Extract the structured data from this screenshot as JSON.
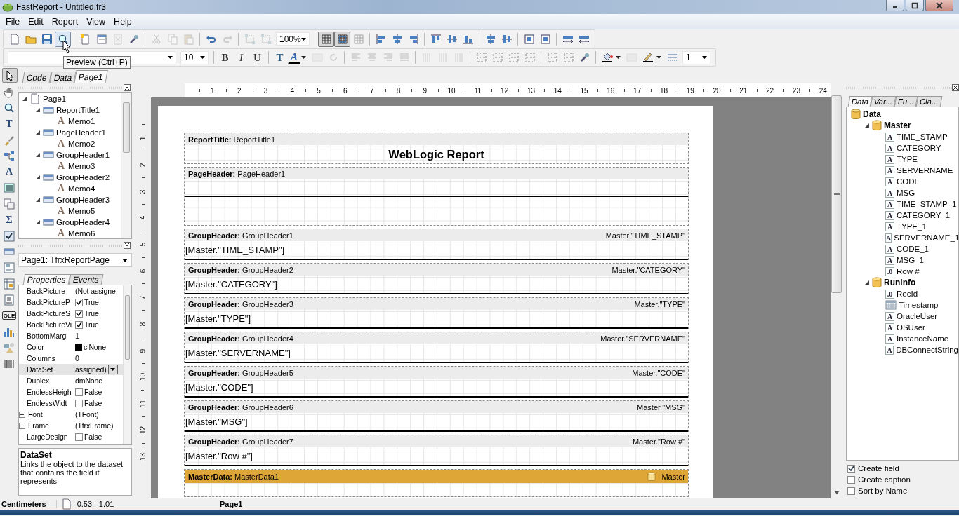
{
  "window": {
    "title": "FastReport - Untitled.fr3"
  },
  "menu": [
    {
      "label": "File"
    },
    {
      "label": "Edit"
    },
    {
      "label": "Report"
    },
    {
      "label": "View"
    },
    {
      "label": "Help"
    }
  ],
  "toolbar_main": [
    {
      "kind": "button",
      "disabled": false,
      "hovered": false,
      "pressed": false
    },
    {
      "kind": "button",
      "disabled": false,
      "hovered": false,
      "pressed": false
    },
    {
      "kind": "button",
      "disabled": false,
      "hovered": false,
      "pressed": false
    },
    {
      "kind": "button",
      "disabled": false,
      "hovered": true,
      "pressed": false
    },
    {
      "kind": "sep"
    },
    {
      "kind": "button",
      "disabled": false,
      "hovered": false,
      "pressed": false
    },
    {
      "kind": "button",
      "disabled": false,
      "hovered": false,
      "pressed": false
    },
    {
      "kind": "button",
      "disabled": true,
      "hovered": false,
      "pressed": false
    },
    {
      "kind": "button",
      "disabled": false,
      "hovered": false,
      "pressed": false
    },
    {
      "kind": "sep"
    },
    {
      "kind": "button",
      "disabled": true,
      "hovered": false,
      "pressed": false
    },
    {
      "kind": "button",
      "disabled": true,
      "hovered": false,
      "pressed": false
    },
    {
      "kind": "button",
      "disabled": true,
      "hovered": false,
      "pressed": false
    },
    {
      "kind": "sep"
    },
    {
      "kind": "button",
      "disabled": false,
      "hovered": false,
      "pressed": false
    },
    {
      "kind": "button",
      "disabled": true,
      "hovered": false,
      "pressed": false
    },
    {
      "kind": "sep"
    },
    {
      "kind": "button",
      "disabled": true,
      "hovered": false,
      "pressed": false
    },
    {
      "kind": "button",
      "disabled": true,
      "hovered": false,
      "pressed": false
    },
    {
      "kind": "combo",
      "value": "100%"
    },
    {
      "kind": "sep"
    },
    {
      "kind": "button",
      "disabled": false,
      "hovered": false,
      "pressed": true
    },
    {
      "kind": "button",
      "disabled": false,
      "hovered": false,
      "pressed": true
    },
    {
      "kind": "button",
      "disabled": true,
      "hovered": false,
      "pressed": false
    },
    {
      "kind": "sep"
    },
    {
      "kind": "button",
      "disabled": false,
      "hovered": false,
      "pressed": false
    },
    {
      "kind": "button",
      "disabled": false,
      "hovered": false,
      "pressed": false
    },
    {
      "kind": "button",
      "disabled": false,
      "hovered": false,
      "pressed": false
    },
    {
      "kind": "sep"
    },
    {
      "kind": "button",
      "disabled": false,
      "hovered": false,
      "pressed": false
    },
    {
      "kind": "button",
      "disabled": false,
      "hovered": false,
      "pressed": false
    },
    {
      "kind": "button",
      "disabled": false,
      "hovered": false,
      "pressed": false
    },
    {
      "kind": "sep"
    },
    {
      "kind": "button",
      "disabled": false,
      "hovered": false,
      "pressed": false
    },
    {
      "kind": "button",
      "disabled": false,
      "hovered": false,
      "pressed": false
    },
    {
      "kind": "sep"
    },
    {
      "kind": "button",
      "disabled": false,
      "hovered": false,
      "pressed": false
    },
    {
      "kind": "button",
      "disabled": false,
      "hovered": false,
      "pressed": false
    },
    {
      "kind": "sep"
    },
    {
      "kind": "button",
      "disabled": false,
      "hovered": false,
      "pressed": false
    },
    {
      "kind": "button",
      "disabled": false,
      "hovered": false,
      "pressed": false
    }
  ],
  "toolbar_format": [
    {
      "kind": "font_combo"
    },
    {
      "kind": "combo",
      "value": "10"
    },
    {
      "kind": "sep"
    },
    {
      "kind": "glyph",
      "text": "B",
      "disabled": false
    },
    {
      "kind": "glyph",
      "text": "I",
      "disabled": false
    },
    {
      "kind": "glyph",
      "text": "U",
      "disabled": false
    },
    {
      "kind": "sep"
    },
    {
      "kind": "glyph",
      "text": "T",
      "disabled": false
    },
    {
      "kind": "glyph",
      "text": "A",
      "disabled": false
    },
    {
      "kind": "dropdown"
    },
    {
      "kind": "button",
      "disabled": true
    },
    {
      "kind": "button",
      "disabled": true
    },
    {
      "kind": "sep"
    },
    {
      "kind": "button",
      "disabled": true
    },
    {
      "kind": "button",
      "disabled": true
    },
    {
      "kind": "button",
      "disabled": true
    },
    {
      "kind": "button",
      "disabled": true
    },
    {
      "kind": "sep"
    },
    {
      "kind": "button",
      "disabled": true
    },
    {
      "kind": "button",
      "disabled": true
    },
    {
      "kind": "button",
      "disabled": true
    },
    {
      "kind": "sep"
    },
    {
      "kind": "button",
      "disabled": false
    },
    {
      "kind": "button",
      "disabled": false
    },
    {
      "kind": "button",
      "disabled": false
    },
    {
      "kind": "button",
      "disabled": false
    },
    {
      "kind": "sep"
    },
    {
      "kind": "button",
      "disabled": false
    },
    {
      "kind": "button",
      "disabled": false
    },
    {
      "kind": "button",
      "disabled": false
    },
    {
      "kind": "sep"
    },
    {
      "kind": "button",
      "disabled": false
    },
    {
      "kind": "dropdown"
    },
    {
      "kind": "button",
      "disabled": true
    },
    {
      "kind": "button",
      "disabled": false
    },
    {
      "kind": "dropdown"
    },
    {
      "kind": "button",
      "disabled": false
    },
    {
      "kind": "combo",
      "value": "1"
    }
  ],
  "tooltip": "Preview (Ctrl+P)",
  "select_tool": {
    "pressed": true
  },
  "doc_tabs": [
    {
      "label": "Code",
      "selected": false
    },
    {
      "label": "Data",
      "selected": false
    },
    {
      "label": "Page1",
      "selected": true
    }
  ],
  "tools": [
    {
      "kind": "icon"
    },
    {
      "kind": "icon"
    },
    {
      "kind": "glyph",
      "label": "T"
    },
    {
      "kind": "icon"
    },
    {
      "kind": "icon"
    },
    {
      "kind": "glyph",
      "label": "A"
    },
    {
      "kind": "icon"
    },
    {
      "kind": "icon"
    },
    {
      "kind": "glyph",
      "label": "Σ"
    },
    {
      "kind": "icon"
    },
    {
      "kind": "icon"
    },
    {
      "kind": "icon"
    },
    {
      "kind": "icon"
    },
    {
      "kind": "icon"
    },
    {
      "kind": "glyph",
      "label": "OLE"
    },
    {
      "kind": "icon"
    },
    {
      "kind": "icon"
    },
    {
      "kind": "icon"
    }
  ],
  "report_tree": [
    {
      "label": "Page1",
      "kind": "page",
      "expanded": true,
      "children": [
        {
          "label": "ReportTitle1",
          "kind": "band",
          "expanded": true,
          "children": [
            {
              "label": "Memo1",
              "kind": "memo",
              "glyph": "A"
            }
          ]
        },
        {
          "label": "PageHeader1",
          "kind": "band",
          "expanded": true,
          "children": [
            {
              "label": "Memo2",
              "kind": "memo",
              "glyph": "A"
            }
          ]
        },
        {
          "label": "GroupHeader1",
          "kind": "band",
          "expanded": true,
          "children": [
            {
              "label": "Memo3",
              "kind": "memo",
              "glyph": "A"
            }
          ]
        },
        {
          "label": "GroupHeader2",
          "kind": "band",
          "expanded": true,
          "children": [
            {
              "label": "Memo4",
              "kind": "memo",
              "glyph": "A"
            }
          ]
        },
        {
          "label": "GroupHeader3",
          "kind": "band",
          "expanded": true,
          "children": [
            {
              "label": "Memo5",
              "kind": "memo",
              "glyph": "A"
            }
          ]
        },
        {
          "label": "GroupHeader4",
          "kind": "band",
          "expanded": true,
          "children": [
            {
              "label": "Memo6",
              "kind": "memo",
              "glyph": "A"
            }
          ]
        }
      ]
    }
  ],
  "object_selector": "Page1: TfrxReportPage",
  "inspector_tabs": [
    {
      "label": "Properties",
      "selected": true
    },
    {
      "label": "Events",
      "selected": false
    }
  ],
  "properties": [
    {
      "name": "BackPicture",
      "value": "(Not assigne",
      "kind": "text",
      "selected": false
    },
    {
      "name": "BackPictureP",
      "value": "True",
      "kind": "check",
      "checked": true,
      "selected": false
    },
    {
      "name": "BackPictureS",
      "value": "True",
      "kind": "check",
      "checked": true,
      "selected": false
    },
    {
      "name": "BackPictureVi",
      "value": "True",
      "kind": "check",
      "checked": true,
      "selected": false
    },
    {
      "name": "BottomMargi",
      "value": "1",
      "kind": "text",
      "selected": false
    },
    {
      "name": "Color",
      "value": "clNone",
      "kind": "color",
      "color": "#000000",
      "selected": false
    },
    {
      "name": "Columns",
      "value": "0",
      "kind": "text",
      "selected": false
    },
    {
      "name": "DataSet",
      "value": "assigned)",
      "kind": "dropdown",
      "selected": true
    },
    {
      "name": "Duplex",
      "value": "dmNone",
      "kind": "text",
      "selected": false
    },
    {
      "name": "EndlessHeigh",
      "value": "False",
      "kind": "check",
      "checked": false,
      "selected": false
    },
    {
      "name": "EndlessWidt",
      "value": "False",
      "kind": "check",
      "checked": false,
      "selected": false
    },
    {
      "name": "Font",
      "value": "(TFont)",
      "kind": "group",
      "expanded": false,
      "selected": false
    },
    {
      "name": "Frame",
      "value": "(TfrxFrame)",
      "kind": "group",
      "expanded": false,
      "selected": false
    },
    {
      "name": "LargeDesign",
      "value": "False",
      "kind": "check",
      "checked": false,
      "selected": false
    }
  ],
  "description": {
    "title": "DataSet",
    "text": "Links the object to the dataset that contains the field it represents"
  },
  "ruler": {
    "horizontal": [
      "1",
      "2",
      "3",
      "4",
      "5",
      "6",
      "7",
      "8",
      "9",
      "10",
      "11",
      "12",
      "13",
      "14",
      "15",
      "16",
      "17",
      "18",
      "19",
      "20",
      "21",
      "22",
      "23",
      "24"
    ],
    "vertical": [
      "1",
      "2",
      "3",
      "4",
      "5",
      "6",
      "7",
      "8",
      "9",
      "10",
      "11",
      "12",
      "13"
    ]
  },
  "bands": [
    {
      "kind": "title",
      "title": "**ReportTitle:** ReportTitle1",
      "memo": "WebLogic Report"
    },
    {
      "kind": "page_header",
      "title": "**PageHeader:** PageHeader1"
    },
    {
      "kind": "group",
      "title": "**GroupHeader:** GroupHeader1",
      "condition": "Master.\"TIME_STAMP\"",
      "memo": "[Master.\"TIME_STAMP\"]"
    },
    {
      "kind": "group",
      "title": "**GroupHeader:** GroupHeader2",
      "condition": "Master.\"CATEGORY\"",
      "memo": "[Master.\"CATEGORY\"]"
    },
    {
      "kind": "group",
      "title": "**GroupHeader:** GroupHeader3",
      "condition": "Master.\"TYPE\"",
      "memo": "[Master.\"TYPE\"]"
    },
    {
      "kind": "group",
      "title": "**GroupHeader:** GroupHeader4",
      "condition": "Master.\"SERVERNAME\"",
      "memo": "[Master.\"SERVERNAME\"]"
    },
    {
      "kind": "group",
      "title": "**GroupHeader:** GroupHeader5",
      "condition": "Master.\"CODE\"",
      "memo": "[Master.\"CODE\"]"
    },
    {
      "kind": "group",
      "title": "**GroupHeader:** GroupHeader6",
      "condition": "Master.\"MSG\"",
      "memo": "[Master.\"MSG\"]"
    },
    {
      "kind": "group",
      "title": "**GroupHeader:** GroupHeader7",
      "condition": "Master.\"Row #\"",
      "memo": "[Master.\"Row #\"]"
    },
    {
      "kind": "data",
      "title": "**MasterData:** MasterData1",
      "dataset": "Master"
    }
  ],
  "data_tabs": [
    {
      "label": "Data",
      "selected": true
    },
    {
      "label": "Var...",
      "selected": false
    },
    {
      "label": "Fu...",
      "selected": false
    },
    {
      "label": "Cla...",
      "selected": false
    }
  ],
  "data_tree": [
    {
      "label": "Data",
      "kind": "database",
      "children": [
        {
          "label": "Master",
          "kind": "database",
          "expanded": true,
          "children": [
            {
              "label": "TIME_STAMP",
              "kind": "field",
              "glyph": "A"
            },
            {
              "label": "CATEGORY",
              "kind": "field",
              "glyph": "A"
            },
            {
              "label": "TYPE",
              "kind": "field",
              "glyph": "A"
            },
            {
              "label": "SERVERNAME",
              "kind": "field",
              "glyph": "A"
            },
            {
              "label": "CODE",
              "kind": "field",
              "glyph": "A"
            },
            {
              "label": "MSG",
              "kind": "field",
              "glyph": "A"
            },
            {
              "label": "TIME_STAMP_1",
              "kind": "field",
              "glyph": "A"
            },
            {
              "label": "CATEGORY_1",
              "kind": "field",
              "glyph": "A"
            },
            {
              "label": "TYPE_1",
              "kind": "field",
              "glyph": "A"
            },
            {
              "label": "SERVERNAME_1",
              "kind": "field",
              "glyph": "A"
            },
            {
              "label": "CODE_1",
              "kind": "field",
              "glyph": "A"
            },
            {
              "label": "MSG_1",
              "kind": "field",
              "glyph": "A"
            },
            {
              "label": "Row #",
              "kind": "field",
              "glyph": ".0"
            }
          ]
        },
        {
          "label": "RunInfo",
          "kind": "database",
          "expanded": true,
          "children": [
            {
              "label": "RecId",
              "kind": "field",
              "glyph": ".0"
            },
            {
              "label": "Timestamp",
              "kind": "date"
            },
            {
              "label": "OracleUser",
              "kind": "field",
              "glyph": "A"
            },
            {
              "label": "OSUser",
              "kind": "field",
              "glyph": "A"
            },
            {
              "label": "InstanceName",
              "kind": "field",
              "glyph": "A"
            },
            {
              "label": "DBConnectString",
              "kind": "field",
              "glyph": "A"
            }
          ]
        }
      ]
    }
  ],
  "data_options": [
    {
      "label": "Create field",
      "checked": true
    },
    {
      "label": "Create caption",
      "checked": false
    },
    {
      "label": "Sort by Name",
      "checked": false
    }
  ],
  "status_bar": {
    "units": "Centimeters",
    "position": "-0.53; -1.01",
    "page": "Page1"
  }
}
